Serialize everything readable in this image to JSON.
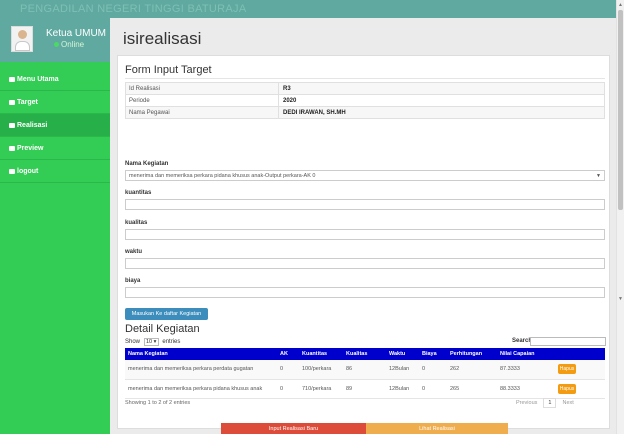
{
  "app": {
    "brand": "PENGADILAN NEGERI TINGGI BATURAJA"
  },
  "sidebar": {
    "user_name": "Ketua UMUM",
    "user_status": "Online",
    "items": [
      {
        "label": "Menu Utama"
      },
      {
        "label": "Target"
      },
      {
        "label": "Realisasi"
      },
      {
        "label": "Preview"
      },
      {
        "label": "logout"
      }
    ]
  },
  "page": {
    "title": "isirealisasi"
  },
  "form": {
    "title": "Form Input Target",
    "info_rows": [
      {
        "label": "Id Realisasi",
        "value": "R3"
      },
      {
        "label": "Periode",
        "value": "2020"
      },
      {
        "label": "Nama Pegawai",
        "value": "DEDI IRAWAN, SH.MH"
      }
    ],
    "nama_kegiatan_label": "Nama Kegiatan",
    "nama_kegiatan_value": "menerima dan memeriksa perkara pidana khusus anak-Output perkara-AK 0",
    "kuantitas_label": "kuantitas",
    "kualitas_label": "kualitas",
    "waktu_label": "waktu",
    "biaya_label": "biaya",
    "submit_label": "Masukan Ke daftar Kegiatan"
  },
  "detail": {
    "title": "Detail Kegiatan",
    "show_label": "Show",
    "show_value": "10",
    "entries_label": "entries",
    "search_label": "Search:",
    "columns": [
      "Nama Kegiatan",
      "AK",
      "Kuantitas",
      "Kualitas",
      "Waktu",
      "Biaya",
      "Perhitungan",
      "Nilai Capaian",
      ""
    ],
    "rows": [
      {
        "nama": "menerima dan memeriksa perkara perdata gugatan",
        "ak": "0",
        "kuantitas": "100/perkara",
        "kualitas": "86",
        "waktu": "12Bulan",
        "biaya": "0",
        "perhitungan": "262",
        "nilai": "87.3333",
        "action": "Hapus"
      },
      {
        "nama": "menerima dan memeriksa perkara pidana khusus anak",
        "ak": "0",
        "kuantitas": "710/perkara",
        "kualitas": "89",
        "waktu": "12Bulan",
        "biaya": "0",
        "perhitungan": "265",
        "nilai": "88.3333",
        "action": "Hapus"
      }
    ],
    "info": "Showing 1 to 2 of 2 entries",
    "prev": "Previous",
    "page": "1",
    "next": "Next"
  },
  "footer": {
    "input_label": "Input Realisasi Baru",
    "lihat_label": "Lihat Realisasi"
  }
}
